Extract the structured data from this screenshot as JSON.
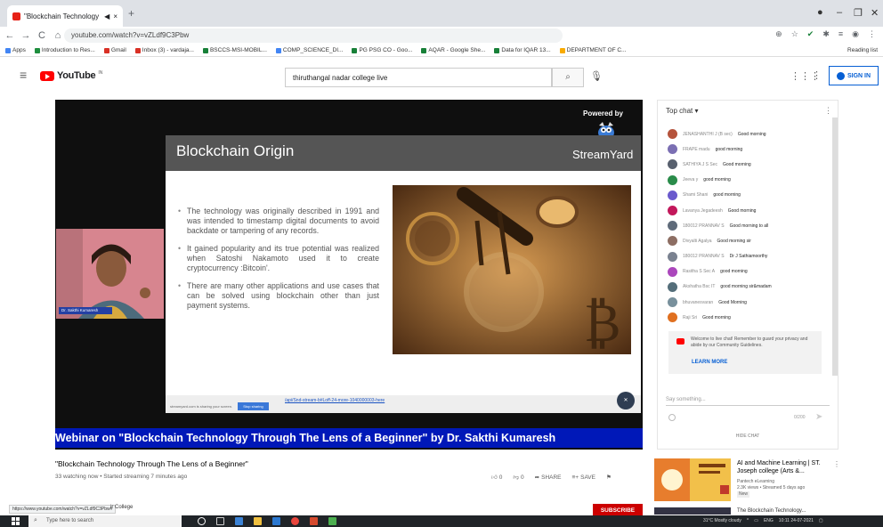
{
  "browser": {
    "tab_title": "\"Blockchain Technology Thr...",
    "tab_audio": "◀",
    "tab_close": "×",
    "new_tab": "+",
    "win_min": "–",
    "win_max": "❐",
    "win_close": "✕",
    "url": "youtube.com/watch?v=vZLdf9C3Pbw",
    "bookmarks": [
      {
        "label": "Apps",
        "color": "#4285f4"
      },
      {
        "label": "Introduction to Res...",
        "color": "#1e8e3e"
      },
      {
        "label": "Gmail",
        "color": "#d93025"
      },
      {
        "label": "Inbox (3) - vardaja...",
        "color": "#d93025"
      },
      {
        "label": "BSCCS-MSI-MOBIL...",
        "color": "#188038"
      },
      {
        "label": "COMP_SCIENCE_DI...",
        "color": "#4285f4"
      },
      {
        "label": "PG PSG CO - Goo...",
        "color": "#188038"
      },
      {
        "label": "AQAR - Google She...",
        "color": "#188038"
      },
      {
        "label": "Data for IQAR 13...",
        "color": "#188038"
      },
      {
        "label": "DEPARTMENT OF C...",
        "color": "#f9ab00"
      }
    ],
    "reading_list": "Reading list"
  },
  "youtube": {
    "logo_text": "YouTube",
    "country": "IN",
    "search_value": "thiruthangal nadar college live",
    "signin_label": "SIGN IN"
  },
  "player": {
    "powered_by": "Powered by",
    "streamyard": "StreamYard",
    "slide_title": "Blockchain  Origin",
    "bullets": [
      "The technology was originally described in 1991 and was intended to timestamp digital documents to avoid backdate or tampering of any records.",
      "It gained popularity and its true potential was realized when Satoshi Nakamoto used it to create cryptocurrency :Bitcoin'.",
      "There are many other applications and use cases that can be solved using blockchain other than just payment systems."
    ],
    "speaker_label": "Dr. Sakthi Kumaresh",
    "ticker": "Webinar on \"Blockchain Technology Through The Lens of a Beginner\" by Dr. Sakthi Kumaresh",
    "slide_link": "/api/Snd-stream-b#Loff-24-more-1040000003-here",
    "slide_btn": "Stop sharing",
    "slide_small": "streamyard.com is sharing your screen."
  },
  "chat": {
    "header": "Top chat ▾",
    "messages": [
      {
        "author": "JENASHANTHI J (B sec)",
        "text": "Good morning",
        "color": "#b5533c"
      },
      {
        "author": "FRAPE madu",
        "text": "good morning",
        "color": "#7b6fb3"
      },
      {
        "author": "SATHIYA J S Sec",
        "text": "Good morning",
        "color": "#58606e"
      },
      {
        "author": "Jeeva y",
        "text": "good morning",
        "color": "#2a8c4a"
      },
      {
        "author": "Shami Shani",
        "text": "good morning",
        "color": "#6a5acd"
      },
      {
        "author": "Lavanya Jegadeesh",
        "text": "Good morning",
        "color": "#c2185b"
      },
      {
        "author": "180012 PRANNAV S",
        "text": "Good morning to all",
        "color": "#5f6b7a"
      },
      {
        "author": "Divyalti Agalya",
        "text": "Good morning sir",
        "color": "#8d6e63"
      },
      {
        "author": "180012 PRANNAV S",
        "text": "Dr J Sathiamoorthy",
        "color": "#7a8290"
      },
      {
        "author": "Rasitha S Sec A",
        "text": "good morning",
        "color": "#ab47bc"
      },
      {
        "author": "Akshatha Bsc IT",
        "text": "good morning sir&madam",
        "color": "#546e7a"
      },
      {
        "author": "bhuvanesvaran",
        "text": "Good Morning",
        "color": "#78909c"
      },
      {
        "author": "Raji Sri",
        "text": "Good morning",
        "color": "#e07020"
      }
    ],
    "welcome_text": "Welcome to live chat! Remember to guard your privacy and abide by our Community Guidelines.",
    "learn_more": "LEARN MORE",
    "input_placeholder": "Say something...",
    "char_count": "0/200",
    "hide_chat": "HIDE CHAT"
  },
  "video": {
    "title": "\"Blockchain Technology Through The Lens of a Beginner\"",
    "meta": "33 watching now • Started streaming 7 minutes ago",
    "likes": "0",
    "dislikes": "0",
    "share": "SHARE",
    "save": "SAVE",
    "subscribe": "SUBSCRIBE",
    "status_url": "https://www.youtube.com/watch?v=vZLdf9C3Pbw#",
    "channel_fragment": "ir College"
  },
  "suggestion": {
    "title": "AI and Machine Learning | ST. Joseph college (Arts &...",
    "channel": "Pantech eLearning",
    "stats": "2.3K views • Streamed 5 days ago",
    "badge": "New",
    "next_title": "The Blockchain Technology..."
  },
  "taskbar": {
    "search_placeholder": "Type here to search",
    "weather": "31°C  Mostly cloudy",
    "lang": "ENG",
    "time": "10:11",
    "date": "24-07-2021"
  }
}
